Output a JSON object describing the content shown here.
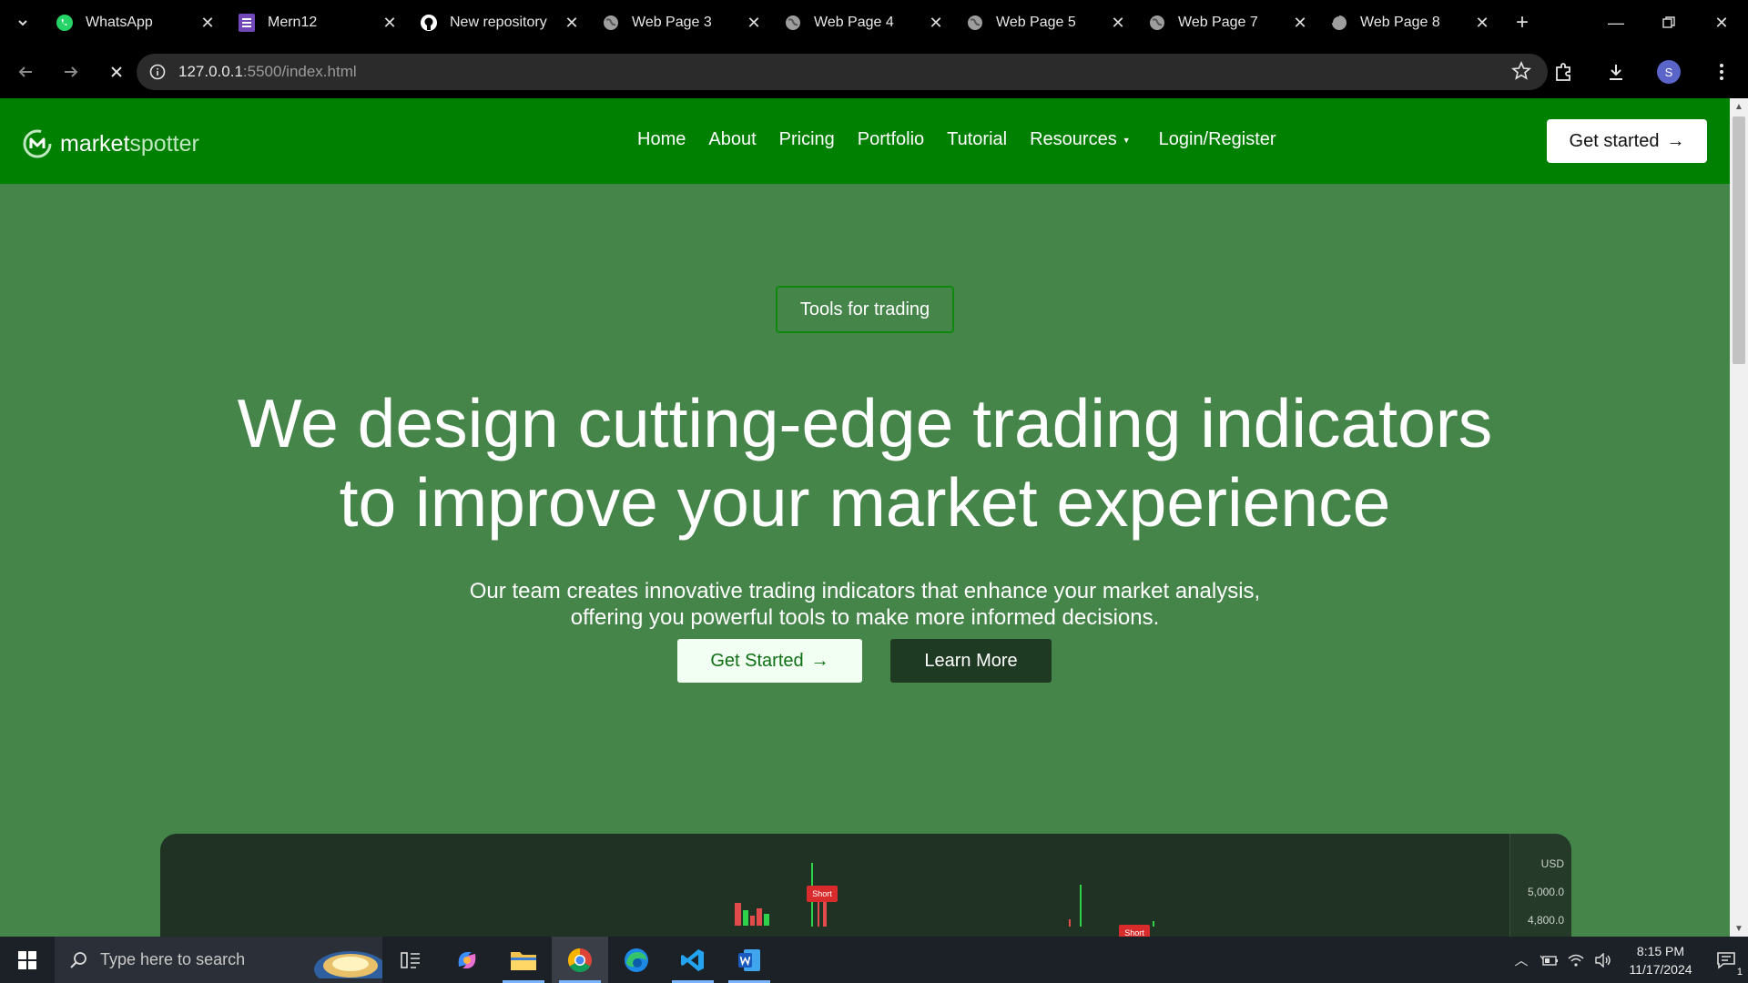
{
  "browser": {
    "tabs": [
      {
        "title": "WhatsApp",
        "icon": "whatsapp-icon"
      },
      {
        "title": "Mern12",
        "icon": "forms-icon"
      },
      {
        "title": "New repository",
        "icon": "github-icon"
      },
      {
        "title": "Web Page 3",
        "icon": "globe-icon"
      },
      {
        "title": "Web Page 4",
        "icon": "globe-icon"
      },
      {
        "title": "Web Page 5",
        "icon": "globe-icon"
      },
      {
        "title": "Web Page 7",
        "icon": "globe-icon"
      },
      {
        "title": "Web Page 8",
        "icon": "loading-globe-icon"
      }
    ],
    "url_host": "127.0.0.1",
    "url_rest": ":5500/index.html",
    "profile_initial": "S"
  },
  "site": {
    "logo_bold": "market",
    "logo_light": "spotter",
    "menu": [
      "Home",
      "About",
      "Pricing",
      "Portfolio",
      "Tutorial",
      "Resources",
      "Login/Register"
    ],
    "cta_label": "Get started",
    "arrow": "→"
  },
  "hero": {
    "pill": "Tools for trading",
    "headline_line1": "We design cutting-edge trading indicators",
    "headline_line2": "to improve your market experience",
    "sub_line1": "Our team creates innovative trading indicators that enhance your market analysis,",
    "sub_line2": "offering you powerful tools to make more informed decisions.",
    "primary_button": "Get Started",
    "secondary_button": "Learn More"
  },
  "chart_preview": {
    "currency": "USD",
    "price_ticks": [
      "5,000.0",
      "4,800.0"
    ],
    "signal_label": "Short"
  },
  "taskbar": {
    "search_placeholder": "Type here to search",
    "time": "8:15 PM",
    "date": "11/17/2024",
    "notification_count": "1"
  },
  "colors": {
    "nav_green": "#008000",
    "hero_green": "#46854a",
    "chart_bg": "#1f3224"
  }
}
